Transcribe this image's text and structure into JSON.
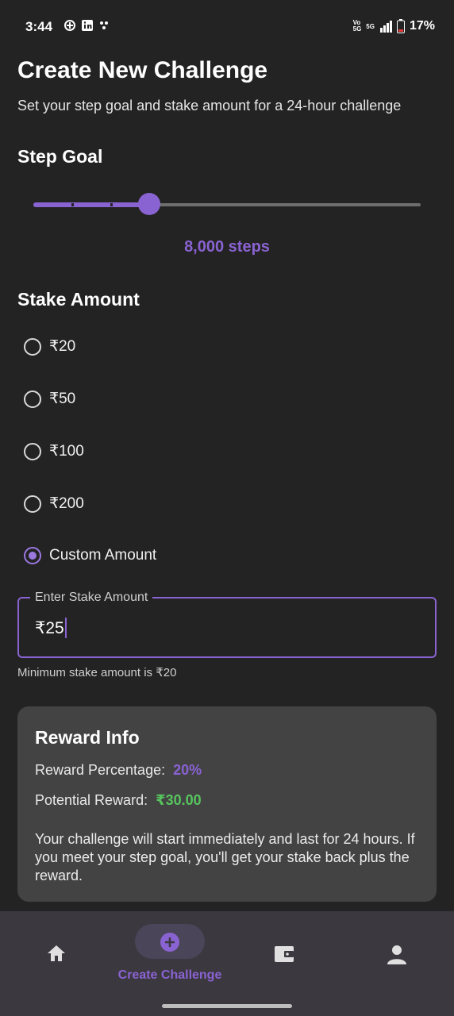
{
  "status_bar": {
    "time": "3:44",
    "left_icons": [
      "fan-app-icon",
      "linkedin-icon",
      "notification-icon"
    ],
    "network": "5G",
    "battery": "17%",
    "right_icons": [
      "volte-icon",
      "signal-icon",
      "battery-icon"
    ]
  },
  "page": {
    "title": "Create New Challenge",
    "subtitle": "Set your step goal and stake amount for a 24-hour challenge"
  },
  "step_goal": {
    "heading": "Step Goal",
    "value_label": "8,000 steps",
    "slider_fraction": 0.3
  },
  "stake": {
    "heading": "Stake Amount",
    "options": [
      {
        "label": "₹20",
        "selected": false
      },
      {
        "label": "₹50",
        "selected": false
      },
      {
        "label": "₹100",
        "selected": false
      },
      {
        "label": "₹200",
        "selected": false
      },
      {
        "label": "Custom Amount",
        "selected": true
      }
    ],
    "input_label": "Enter Stake Amount",
    "input_value": "₹25",
    "helper": "Minimum stake amount is ₹20"
  },
  "reward": {
    "title": "Reward Info",
    "percentage_label": "Reward Percentage:",
    "percentage_value": "20%",
    "potential_label": "Potential Reward:",
    "potential_value": "₹30.00",
    "description": "Your challenge will start immediately and last for 24 hours. If you meet your step goal, you'll get your stake back plus the reward."
  },
  "nav": {
    "items": [
      {
        "icon": "home-icon",
        "label": ""
      },
      {
        "icon": "add-circle-icon",
        "label": "Create Challenge"
      },
      {
        "icon": "wallet-icon",
        "label": ""
      },
      {
        "icon": "profile-icon",
        "label": ""
      }
    ],
    "active_label": "Create Challenge"
  },
  "colors": {
    "background": "#232323",
    "accent": "#8a63d2",
    "green": "#57c45e",
    "card": "#434343",
    "navbar": "#3b383f"
  }
}
